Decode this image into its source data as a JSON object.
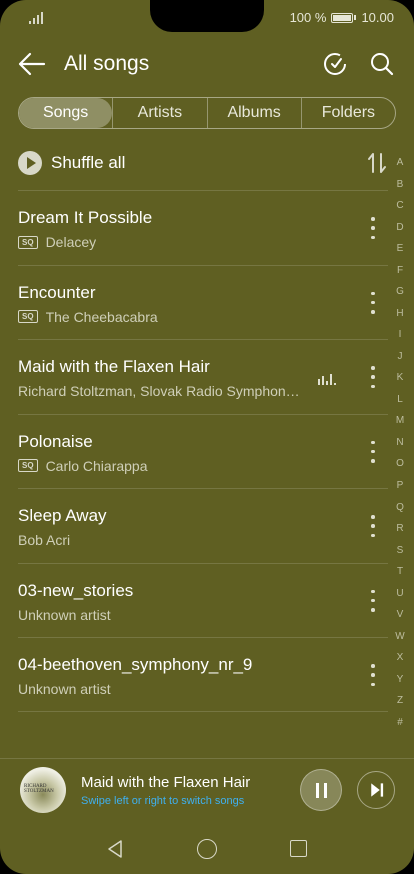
{
  "status": {
    "battery_text": "100 %",
    "time": "10.00"
  },
  "header": {
    "title": "All songs"
  },
  "tabs": [
    {
      "label": "Songs",
      "active": true
    },
    {
      "label": "Artists",
      "active": false
    },
    {
      "label": "Albums",
      "active": false
    },
    {
      "label": "Folders",
      "active": false
    }
  ],
  "shuffle": {
    "label": "Shuffle all"
  },
  "songs": [
    {
      "title": "Dream It Possible",
      "artist": "Delacey",
      "badge": "SQ"
    },
    {
      "title": "Encounter",
      "artist": "The Cheebacabra",
      "badge": "SQ"
    },
    {
      "title": "Maid with the Flaxen Hair",
      "artist": "Richard Stoltzman, Slovak Radio Symphon…",
      "badge": "",
      "playing": true
    },
    {
      "title": "Polonaise",
      "artist": "Carlo Chiarappa",
      "badge": "SQ"
    },
    {
      "title": "Sleep Away",
      "artist": "Bob Acri",
      "badge": ""
    },
    {
      "title": "03-new_stories",
      "artist": "Unknown artist",
      "badge": ""
    },
    {
      "title": "04-beethoven_symphony_nr_9",
      "artist": "Unknown artist",
      "badge": ""
    }
  ],
  "alpha_index": [
    "A",
    "B",
    "C",
    "D",
    "E",
    "F",
    "G",
    "H",
    "I",
    "J",
    "K",
    "L",
    "M",
    "N",
    "O",
    "P",
    "Q",
    "R",
    "S",
    "T",
    "U",
    "V",
    "W",
    "X",
    "Y",
    "Z",
    "#"
  ],
  "now_playing": {
    "title": "Maid with the Flaxen Hair",
    "hint": "Swipe left or right to switch songs",
    "cover_text_line1": "RICHARD",
    "cover_text_line2": "STOLTZMAN"
  },
  "colors": {
    "background": "#5f5f22",
    "accent": "#3fb0f0"
  }
}
